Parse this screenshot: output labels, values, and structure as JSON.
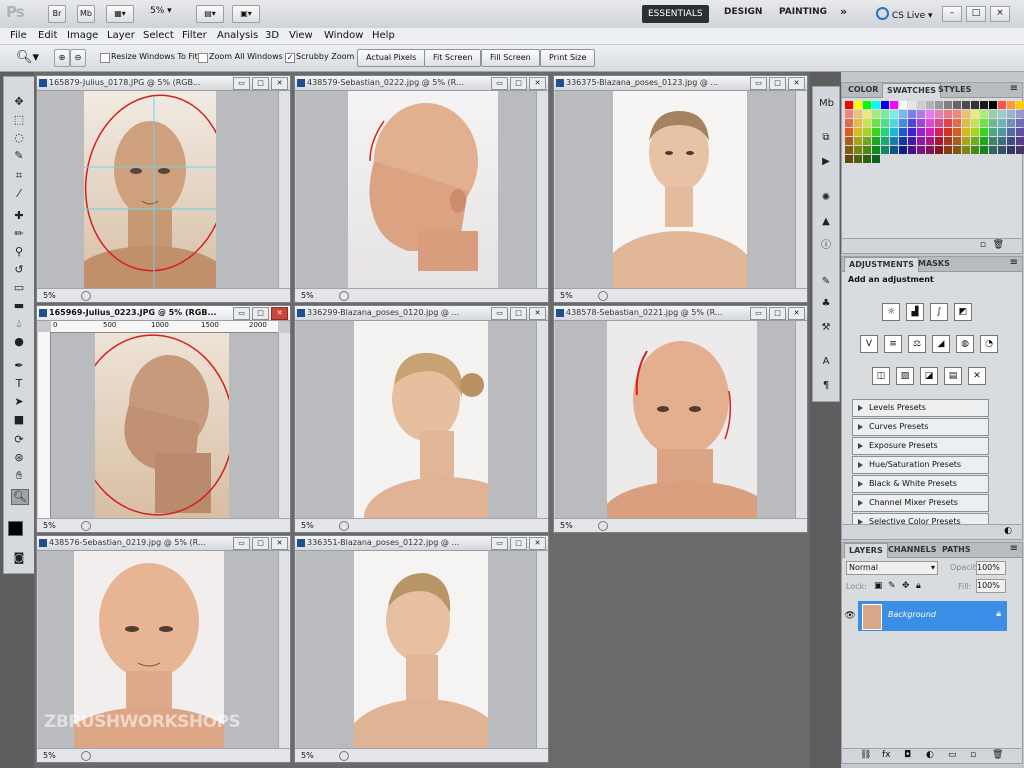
{
  "app": {
    "logo": "Ps",
    "zoom": "5%",
    "workspaces": [
      "ESSENTIALS",
      "DESIGN",
      "PAINTING"
    ],
    "workspace_more": "»",
    "cs_live": "CS Live",
    "window_controls": [
      "–",
      "□",
      "×"
    ]
  },
  "menu": [
    "File",
    "Edit",
    "Image",
    "Layer",
    "Select",
    "Filter",
    "Analysis",
    "3D",
    "View",
    "Window",
    "Help"
  ],
  "options": {
    "resize_windows": "Resize Windows To Fit",
    "zoom_all": "Zoom All Windows",
    "scrubby_zoom": "Scrubby Zoom",
    "scrubby_checked": true,
    "buttons": [
      "Actual Pixels",
      "Fit Screen",
      "Fill Screen",
      "Print Size"
    ]
  },
  "documents": [
    {
      "title": "165879-Julius_0178.JPG @ 5% (RGB...",
      "zoom": "5%",
      "active": false
    },
    {
      "title": "438579-Sebastian_0222.jpg @ 5% (R...",
      "zoom": "5%",
      "active": false
    },
    {
      "title": "336375-Blazana_poses_0123.jpg @ ...",
      "zoom": "5%",
      "active": false
    },
    {
      "title": "165969-Julius_0223.JPG @ 5% (RGB...",
      "zoom": "5%",
      "active": true
    },
    {
      "title": "336299-Blazana_poses_0120.jpg @ ...",
      "zoom": "5%",
      "active": false
    },
    {
      "title": "438578-Sebastian_0221.jpg @ 5% (R...",
      "zoom": "5%",
      "active": false
    },
    {
      "title": "438576-Sebastian_0219.jpg @ 5% (R...",
      "zoom": "5%",
      "active": false
    },
    {
      "title": "336351-Blazana_poses_0122.jpg @ ...",
      "zoom": "5%",
      "active": false
    }
  ],
  "ruler_marks": [
    "0",
    "500",
    "1000",
    "1500",
    "2000"
  ],
  "panels": {
    "color_tabs": [
      "COLOR",
      "SWATCHES",
      "STYLES"
    ],
    "adjustments_tabs": [
      "ADJUSTMENTS",
      "MASKS"
    ],
    "adjustments_heading": "Add an adjustment",
    "presets": [
      "Levels Presets",
      "Curves Presets",
      "Exposure Presets",
      "Hue/Saturation Presets",
      "Black & White Presets",
      "Channel Mixer Presets",
      "Selective Color Presets"
    ],
    "layers_tabs": [
      "LAYERS",
      "CHANNELS",
      "PATHS"
    ],
    "blend_mode": "Normal",
    "opacity_label": "Opacity:",
    "opacity": "100%",
    "lock_label": "Lock:",
    "fill_label": "Fill:",
    "fill": "100%",
    "layer_name": "Background"
  },
  "watermark": "ZBRUSHWORKSHOPS",
  "colors": {
    "accent": "#3a8ee6",
    "active_close": "#c9463d",
    "annotation": "#d42020"
  }
}
